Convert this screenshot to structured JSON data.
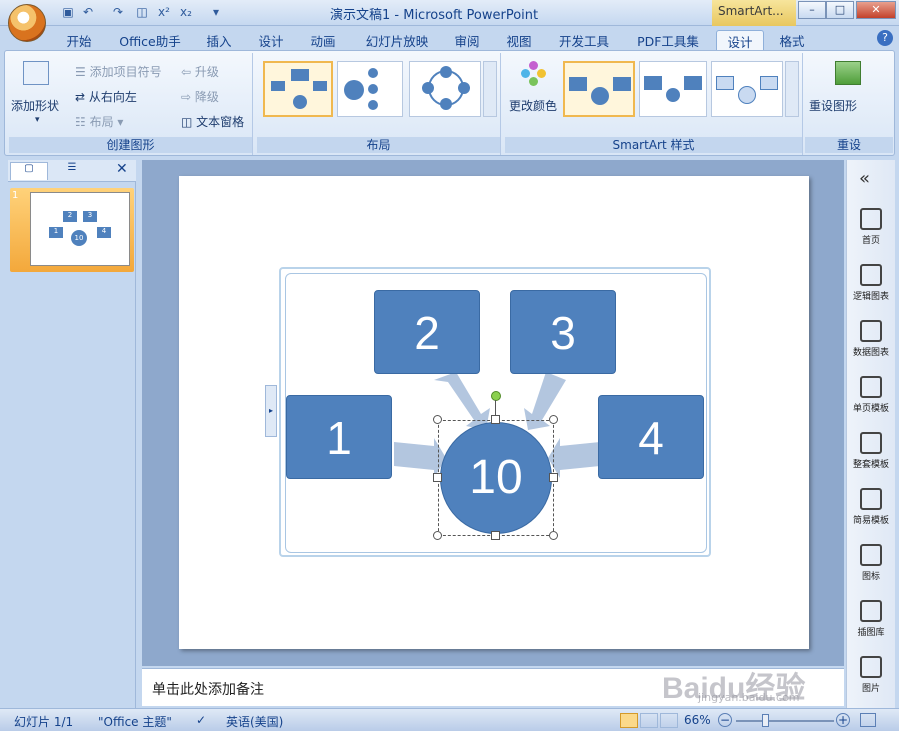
{
  "window": {
    "title": "演示文稿1 - Microsoft PowerPoint",
    "context_tab": "SmartArt...",
    "min": "–",
    "max": "□",
    "close": "✕"
  },
  "tabs": [
    {
      "label": "开始"
    },
    {
      "label": "Office助手"
    },
    {
      "label": "插入"
    },
    {
      "label": "设计"
    },
    {
      "label": "动画"
    },
    {
      "label": "幻灯片放映"
    },
    {
      "label": "审阅"
    },
    {
      "label": "视图"
    },
    {
      "label": "开发工具"
    },
    {
      "label": "PDF工具集"
    },
    {
      "label": "设计",
      "active": true
    },
    {
      "label": "格式"
    }
  ],
  "ribbon": {
    "create_graphic": {
      "label": "创建图形",
      "add_shape": "添加形状",
      "add_bullet": "添加项目符号",
      "right_to_left": "从右向左",
      "layout": "布局",
      "promote": "升级",
      "demote": "降级",
      "text_pane": "文本窗格"
    },
    "layouts": {
      "label": "布局"
    },
    "styles": {
      "label": "SmartArt 样式",
      "change_colors": "更改颜色"
    },
    "reset": {
      "label": "重设",
      "reset_graphic": "重设图形"
    }
  },
  "slides_panel": {
    "slide_number": "1",
    "thumb_nodes": [
      "2",
      "3",
      "1",
      "10",
      "4"
    ]
  },
  "smartart": {
    "nodes": [
      "2",
      "3",
      "1",
      "4"
    ],
    "center": "10",
    "accent": "#4f81bd",
    "arrow_color": "#b3c6df"
  },
  "notes": {
    "placeholder": "单击此处添加备注"
  },
  "right_pane": {
    "collapse": "«",
    "items": [
      "首页",
      "逻辑图表",
      "数据图表",
      "单页模板",
      "整套模板",
      "简易模板",
      "图标",
      "插图库",
      "图片"
    ]
  },
  "status": {
    "slide": "幻灯片 1/1",
    "theme": "\"Office 主题\"",
    "language": "英语(美国)",
    "zoom": "66%"
  },
  "watermark": {
    "text": "Baidu经验",
    "url": "jingyan.baidu.com"
  }
}
